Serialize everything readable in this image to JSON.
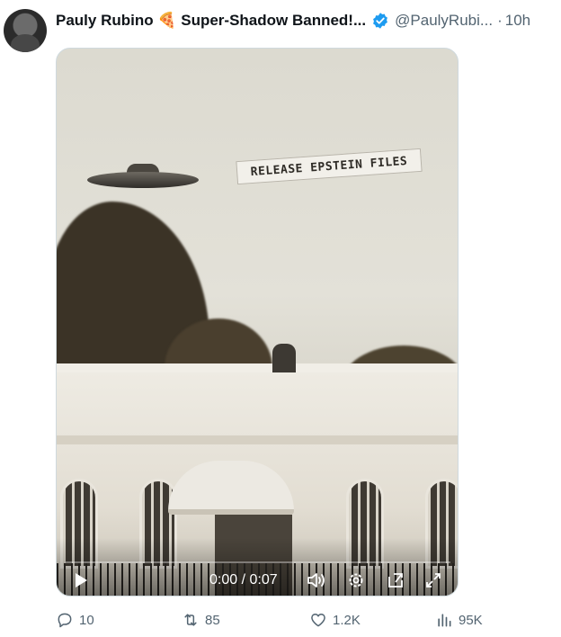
{
  "post": {
    "author_name": "Pauly Rubino 🍕 Super-Shadow Banned!...",
    "handle": "@PaulyRubi...",
    "separator": "·",
    "time": "10h",
    "verified_color": "#1d9bf0"
  },
  "media": {
    "banner_text": "RELEASE EPSTEIN FILES",
    "timecode": "0:00 / 0:07"
  },
  "actions": {
    "replies": "10",
    "reposts": "85",
    "likes": "1.2K",
    "views": "95K"
  },
  "icons": [
    "avatar",
    "verified-badge-icon",
    "play-icon",
    "volume-icon",
    "settings-gear-icon",
    "picture-in-picture-icon",
    "fullscreen-icon",
    "reply-icon",
    "repost-icon",
    "like-icon",
    "views-icon"
  ],
  "colors": {
    "text": "#0f1419",
    "secondary": "#536471",
    "verified": "#1d9bf0"
  }
}
